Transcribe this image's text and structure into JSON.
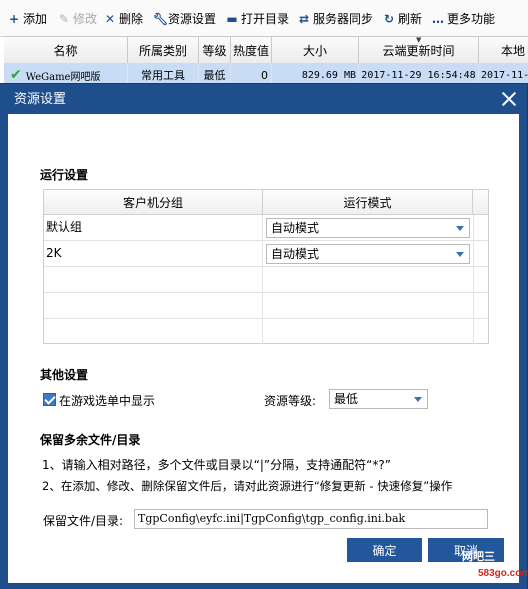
{
  "toolbar": {
    "add": "添加",
    "edit": "修改",
    "delete": "删除",
    "resource_settings": "资源设置",
    "open_dir": "打开目录",
    "server_sync": "服务器同步",
    "refresh": "刷新",
    "more": "更多功能"
  },
  "grid": {
    "columns": [
      "名称",
      "所属类别",
      "等级",
      "热度值",
      "大小",
      "云端更新时间",
      "本地"
    ],
    "row": {
      "name": "WeGame网吧版",
      "category": "常用工具",
      "level": "最低",
      "heat": "0",
      "size": "829.69 MB",
      "cloud_time": "2017-11-29 16:54:48",
      "local": "2017-11-"
    }
  },
  "dialog": {
    "title": "资源设置",
    "run_settings": {
      "title": "运行设置",
      "columns": [
        "客户机分组",
        "运行模式"
      ],
      "rows": [
        {
          "group": "默认组",
          "mode": "自动模式"
        },
        {
          "group": "2K",
          "mode": "自动模式"
        }
      ]
    },
    "other_settings": {
      "title": "其他设置",
      "show_in_menu_label": "在游戏选单中显示",
      "show_in_menu_checked": true,
      "level_label": "资源等级:",
      "level_value": "最低"
    },
    "keep_files": {
      "title": "保留多余文件/目录",
      "note1": "1、请输入相对路径，多个文件或目录以“|”分隔，支持通配符“*?”",
      "note2": "2、在添加、修改、删除保留文件后，请对此资源进行“修复更新 - 快速修复”操作",
      "field_label": "保留文件/目录:",
      "field_value": "TgpConfig\\eyfc.ini|TgpConfig\\tgp_config.ini.bak"
    },
    "ok_label": "确定",
    "cancel_label": "取消"
  },
  "watermark": {
    "logo_text": "网吧三",
    "site": "583go.com"
  },
  "colors": {
    "dialog_frame": "#1f4e8c",
    "button": "#22579b",
    "selected_row": "#c8ddf5"
  }
}
